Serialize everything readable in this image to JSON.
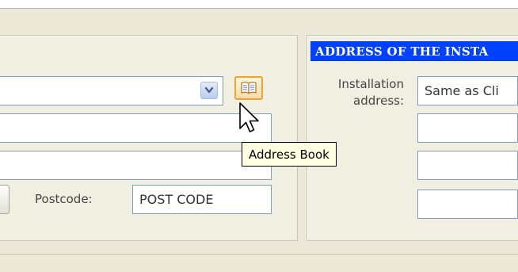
{
  "client_section": {
    "postcode_label": "Postcode:",
    "postcode_value": "POST CODE",
    "address_book_tooltip": "Address Book"
  },
  "installation_section": {
    "header": "ADDRESS OF THE INSTA",
    "installation_label_line1": "Installation",
    "installation_label_line2": "address:",
    "installation_select_value": "Same as Cli"
  },
  "icons": {
    "dropdown": "chevron-down-icon",
    "address_book": "book-icon",
    "cursor": "mouse-pointer-icon"
  },
  "colors": {
    "header_bg": "#0041ff",
    "tooltip_bg": "#ffffe1",
    "book_button_border": "#e7a53b"
  }
}
